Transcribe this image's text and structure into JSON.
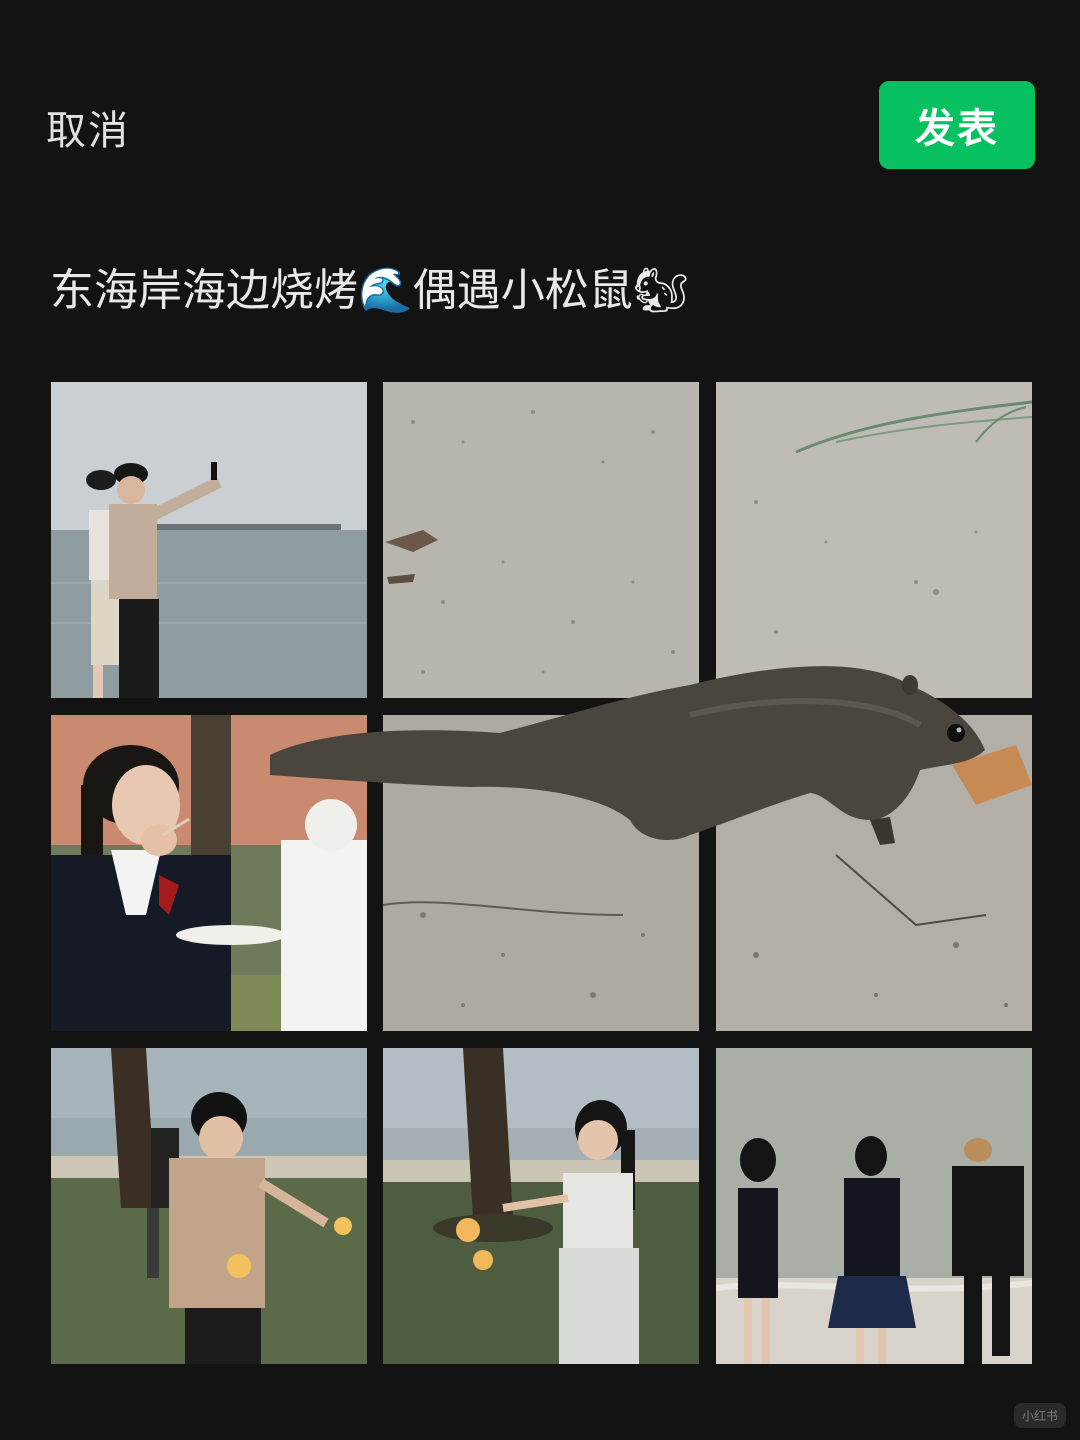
{
  "header": {
    "cancel_label": "取消",
    "publish_label": "发表"
  },
  "post": {
    "caption": "东海岸海边烧烤🌊偶遇小松鼠🐿"
  },
  "colors": {
    "background": "#131313",
    "publish_button": "#07c160"
  },
  "photos": [
    {
      "subject": "two people taking a selfie by the sea"
    },
    {
      "subject": "sand close-up"
    },
    {
      "subject": "sand close-up with grass"
    },
    {
      "subject": "person eating with chopsticks holding a plate"
    },
    {
      "subject": "squirrel on sand"
    },
    {
      "subject": "squirrel nibbling food on sand"
    },
    {
      "subject": "person holding a sparkler under a tree"
    },
    {
      "subject": "girl holding sparklers by the beach"
    },
    {
      "subject": "three people in suits walking toward the sea"
    }
  ],
  "watermark": "小红书"
}
